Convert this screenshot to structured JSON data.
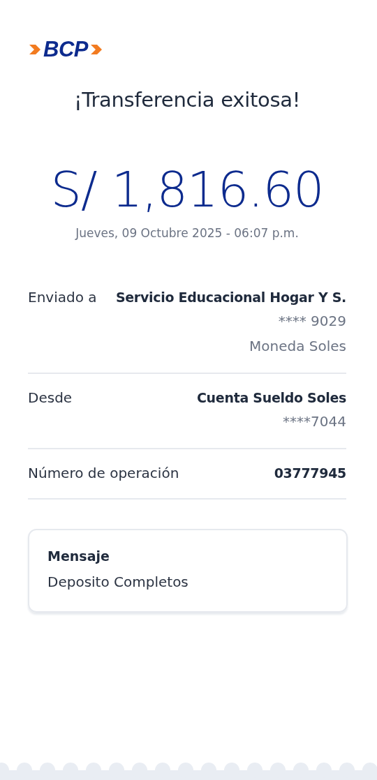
{
  "logo": {
    "text": "BCP"
  },
  "title": "¡Transferencia exitosa!",
  "amount": "S/ 1,816.60",
  "datetime": "Jueves, 09 Octubre 2025 - 06:07 p.m.",
  "details": [
    {
      "label": "Enviado a",
      "values": [
        {
          "text": "Servicio Educacional Hogar Y S.",
          "kind": "strong"
        },
        {
          "text": "**** 9029",
          "kind": "muted"
        },
        {
          "text": "Moneda Soles",
          "kind": "muted"
        }
      ]
    },
    {
      "label": "Desde",
      "values": [
        {
          "text": "Cuenta Sueldo Soles",
          "kind": "strong"
        },
        {
          "text": "****7044",
          "kind": "muted"
        }
      ]
    },
    {
      "label": "Número de operación",
      "values": [
        {
          "text": "03777945",
          "kind": "strong"
        }
      ]
    }
  ],
  "message": {
    "title": "Mensaje",
    "text": "Deposito Completos"
  }
}
